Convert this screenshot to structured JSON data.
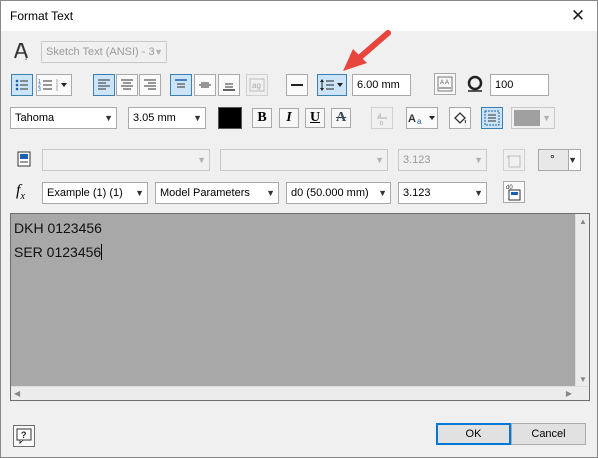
{
  "window": {
    "title": "Format Text"
  },
  "row1": {
    "style_value": "Sketch Text (ANSI) - 3"
  },
  "row2": {
    "line_spacing_value": "6.00 mm",
    "width_factor_value": "100"
  },
  "row3": {
    "font_value": "Tahoma",
    "size_value": "3.05 mm",
    "bold_label": "B",
    "italic_label": "I",
    "underline_label": "U",
    "strike_label": "A"
  },
  "row4": {
    "precision_value": "3.123",
    "symbol_label": "°"
  },
  "row5": {
    "parameter_source": "Example (1) (1)",
    "parameter_type": "Model Parameters",
    "parameter_value": "d0 (50.000 mm)",
    "precision_value": "3.123",
    "fx_label": "f",
    "fx_sub": "x"
  },
  "editor": {
    "lines": [
      "DKH 0123456",
      "SER 0123456"
    ]
  },
  "footer": {
    "ok_label": "OK",
    "cancel_label": "Cancel"
  },
  "colors": {
    "accent": "#0078d7",
    "annotation_arrow": "#e8453c",
    "editor_bg": "#a8a8a8"
  }
}
